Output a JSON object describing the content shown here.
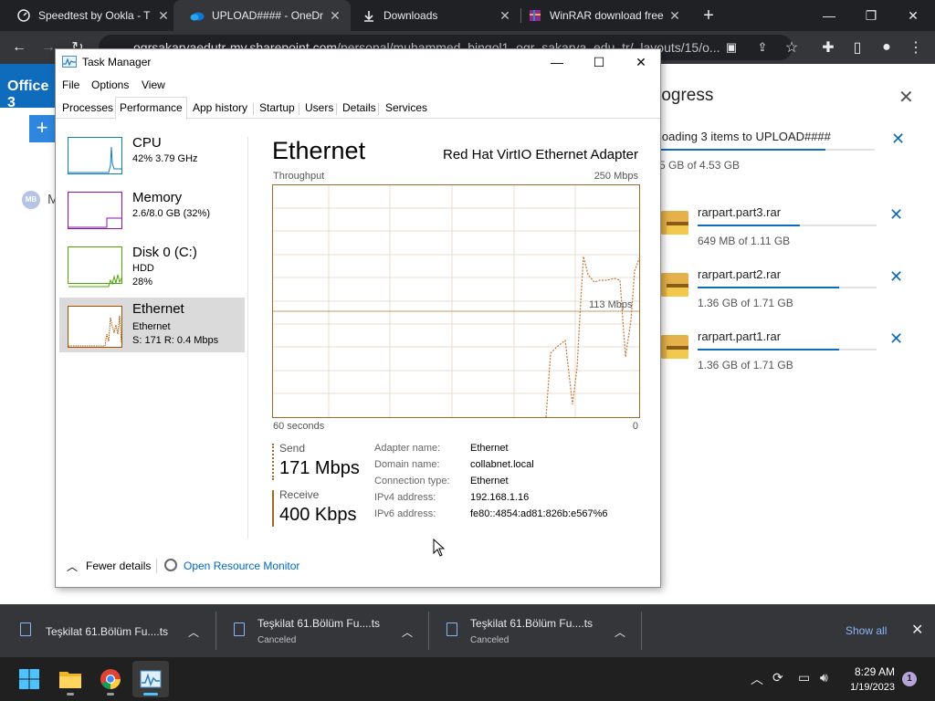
{
  "browser": {
    "tabs": [
      {
        "label": "Speedtest by Ookla - T",
        "icon": "speedtest-icon"
      },
      {
        "label": "UPLOAD#### - OneDr",
        "icon": "onedrive-icon"
      },
      {
        "label": "Downloads",
        "icon": "download-icon"
      },
      {
        "label": "WinRAR download free",
        "icon": "winrar-icon"
      }
    ],
    "new_tab": "+",
    "url_prefix": "ogrsakaryaedutr-my.sharepoint.com",
    "url_rest": "/personal/muhammed_bingol1_ogr_sakarya_edu_tr/_layouts/15/o..."
  },
  "webpage": {
    "office_label": "Office 3",
    "new_button": "+",
    "avatar": "MB",
    "name_initial": "M",
    "progress": {
      "title": "rogress",
      "summary_name": "loading 3 items to UPLOAD####",
      "summary_size": "5 GB of 4.53 GB",
      "summary_fraction": 0.77,
      "items": [
        {
          "name": "rarpart.part3.rar",
          "size": "649 MB of 1.11 GB",
          "fraction": 0.57
        },
        {
          "name": "rarpart.part2.rar",
          "size": "1.36 GB of 1.71 GB",
          "fraction": 0.79
        },
        {
          "name": "rarpart.part1.rar",
          "size": "1.36 GB of 1.71 GB",
          "fraction": 0.79
        }
      ]
    }
  },
  "task_manager": {
    "title": "Task Manager",
    "menu": [
      "File",
      "Options",
      "View"
    ],
    "tabs": [
      "Processes",
      "Performance",
      "App history",
      "Startup",
      "Users",
      "Details",
      "Services"
    ],
    "active_tab": "Performance",
    "resources": [
      {
        "name": "CPU",
        "line1": "42% 3.79 GHz",
        "line2": "",
        "color": "#117dbb"
      },
      {
        "name": "Memory",
        "line1": "2.6/8.0 GB (32%)",
        "line2": "",
        "color": "#8b12ae"
      },
      {
        "name": "Disk 0 (C:)",
        "line1": "HDD",
        "line2": "28%",
        "color": "#4da60c"
      },
      {
        "name": "Ethernet",
        "line1": "Ethernet",
        "line2": "S: 171 R: 0.4 Mbps",
        "color": "#a74f01"
      }
    ],
    "detail": {
      "title": "Ethernet",
      "adapter": "Red Hat VirtIO Ethernet Adapter",
      "graph_label": "Throughput",
      "graph_max": "250 Mbps",
      "graph_mid": "113 Mbps",
      "graph_time": "60 seconds",
      "graph_zero": "0",
      "send_label": "Send",
      "send_value": "171 Mbps",
      "receive_label": "Receive",
      "receive_value": "400 Kbps",
      "properties": [
        {
          "key": "Adapter name:",
          "value": "Ethernet"
        },
        {
          "key": "Domain name:",
          "value": "collabnet.local"
        },
        {
          "key": "Connection type:",
          "value": "Ethernet"
        },
        {
          "key": "IPv4 address:",
          "value": "192.168.1.16"
        },
        {
          "key": "IPv6 address:",
          "value": "fe80::4854:ad81:826b:e567%6"
        }
      ]
    },
    "fewer_details": "Fewer details",
    "open_resource_monitor": "Open Resource Monitor"
  },
  "downloads_shelf": {
    "items": [
      {
        "name": "Teşkilat 61.Bölüm Fu....ts",
        "status": ""
      },
      {
        "name": "Teşkilat 61.Bölüm Fu....ts",
        "status": "Canceled"
      },
      {
        "name": "Teşkilat 61.Bölüm Fu....ts",
        "status": "Canceled"
      }
    ],
    "show_all": "Show all"
  },
  "taskbar": {
    "time": "8:29 AM",
    "date": "1/19/2023",
    "notifications": "1"
  }
}
